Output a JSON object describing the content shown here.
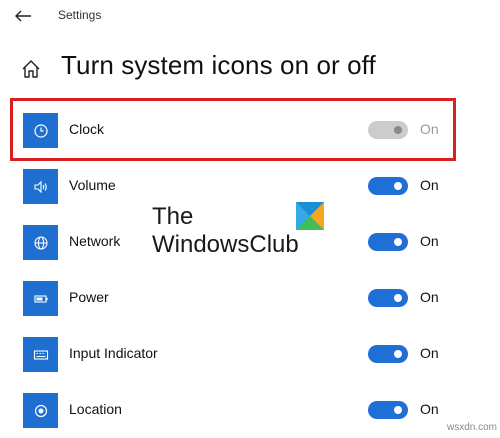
{
  "window": {
    "title": "Settings"
  },
  "page": {
    "title": "Turn system icons on or off"
  },
  "icons": {
    "back": "back-arrow",
    "home": "home"
  },
  "colors": {
    "accent": "#1e6fd0",
    "highlight": "#d92020",
    "toggle_off": "#cccccc"
  },
  "items": [
    {
      "label": "Clock",
      "icon": "clock",
      "state": "On",
      "enabled": false
    },
    {
      "label": "Volume",
      "icon": "volume",
      "state": "On",
      "enabled": true
    },
    {
      "label": "Network",
      "icon": "network",
      "state": "On",
      "enabled": true
    },
    {
      "label": "Power",
      "icon": "power",
      "state": "On",
      "enabled": true
    },
    {
      "label": "Input Indicator",
      "icon": "input-indicator",
      "state": "On",
      "enabled": true
    },
    {
      "label": "Location",
      "icon": "location",
      "state": "On",
      "enabled": true
    }
  ],
  "watermark": {
    "line1": "The",
    "line2": "WindowsClub"
  },
  "credit": "wsxdn.com"
}
